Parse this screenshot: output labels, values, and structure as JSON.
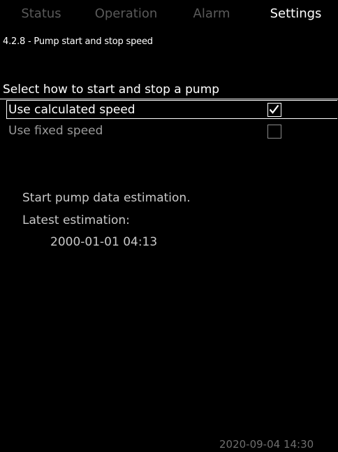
{
  "tabs": [
    {
      "label": "Status",
      "active": false
    },
    {
      "label": "Operation",
      "active": false
    },
    {
      "label": "Alarm",
      "active": false
    },
    {
      "label": "Settings",
      "active": true
    }
  ],
  "screen": {
    "title": "4.2.8 - Pump start and stop speed",
    "section_heading": "Select how to start and stop a pump"
  },
  "options": [
    {
      "label": "Use calculated speed",
      "checked": true,
      "selected": true
    },
    {
      "label": "Use fixed speed",
      "checked": false,
      "selected": false
    }
  ],
  "estimation": {
    "action_label": "Start pump data estimation.",
    "latest_label": "Latest estimation:",
    "latest_value": "2000-01-01  04:13"
  },
  "footer": {
    "datetime": "2020-09-04  14:30"
  },
  "icons": {
    "checkmark": "checkmark-icon"
  },
  "colors": {
    "background": "#000000",
    "text": "#ffffff",
    "inactive_tab": "#5a5a5a",
    "dim_text": "#9a9a9a"
  }
}
